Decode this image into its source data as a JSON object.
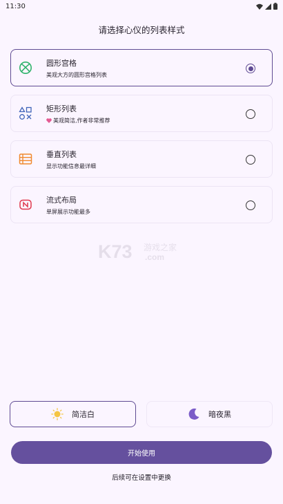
{
  "status_bar": {
    "time": "11:30",
    "icons": [
      "wifi-icon",
      "signal-icon",
      "battery-icon"
    ]
  },
  "page": {
    "title": "请选择心仪的列表样式"
  },
  "options": [
    {
      "title": "圆形宫格",
      "subtitle": "美观大方的圆形宫格列表",
      "icon": "xbox-icon",
      "selected": true
    },
    {
      "title": "矩形列表",
      "subtitle": "美观简洁,作者非常推荐",
      "icon": "playstation-icon",
      "badge_icon": "heart-icon",
      "selected": false
    },
    {
      "title": "垂直列表",
      "subtitle": "显示功能信息最详细",
      "icon": "list-icon",
      "selected": false
    },
    {
      "title": "流式布局",
      "subtitle": "单屏展示功能最多",
      "icon": "nintendo-icon",
      "selected": false
    }
  ],
  "watermark": {
    "brand": "K73",
    "text": "游戏之家",
    "domain": ".com"
  },
  "theme": {
    "light_label": "简洁白",
    "dark_label": "暗夜黑",
    "selected": "light"
  },
  "start_button": "开始使用",
  "footer_note": "后续可在设置中更换",
  "colors": {
    "accent": "#65509e",
    "background": "#fbf5ff",
    "xbox_green": "#2fb36b",
    "ps_blue": "#3f63b8",
    "list_orange": "#f08a2e",
    "nintendo_red": "#e0364b"
  }
}
